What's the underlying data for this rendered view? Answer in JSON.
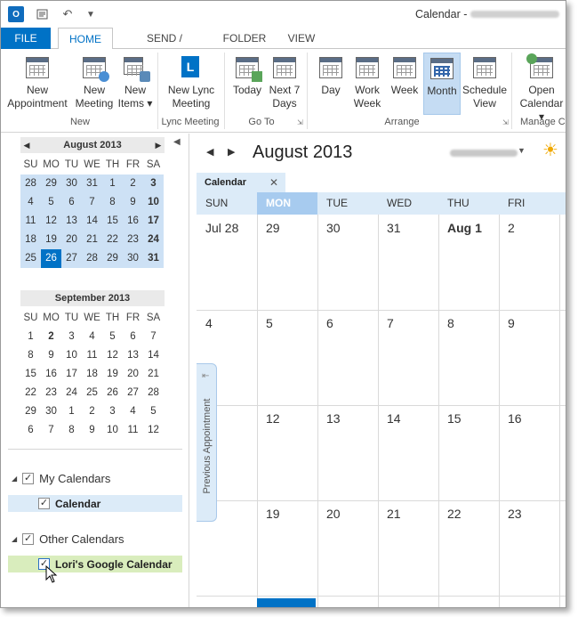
{
  "title_bar": {
    "title": "Calendar -",
    "app_icon_text": "O",
    "icons": [
      "outlook-app-icon",
      "send-receive-icon",
      "undo-icon",
      "customize-quick-access-icon"
    ]
  },
  "tabs": [
    "FILE",
    "HOME",
    "SEND / RECEIVE",
    "FOLDER",
    "VIEW"
  ],
  "ribbon": {
    "buttons": {
      "new_appointment": "New\nAppointment",
      "new_meeting": "New\nMeeting",
      "new_items": "New\nItems ▾",
      "new_lync_meeting": "New Lync\nMeeting",
      "today": "Today",
      "next7": "Next 7\nDays",
      "day": "Day",
      "work_week": "Work\nWeek",
      "week": "Week",
      "month": "Month",
      "schedule_view": "Schedule\nView",
      "open_calendar": "Open\nCalendar ▾"
    },
    "groups": {
      "new": "New",
      "lync_meeting": "Lync Meeting",
      "go_to": "Go To",
      "arrange": "Arrange",
      "manage": "Manage C"
    }
  },
  "nav_pane": {
    "august": {
      "header": "August 2013",
      "dows": [
        "SU",
        "MO",
        "TU",
        "WE",
        "TH",
        "FR",
        "SA"
      ],
      "weeks": [
        [
          "28",
          "29",
          "30",
          "31",
          "1",
          "2",
          "3"
        ],
        [
          "4",
          "5",
          "6",
          "7",
          "8",
          "9",
          "10"
        ],
        [
          "11",
          "12",
          "13",
          "14",
          "15",
          "16",
          "17"
        ],
        [
          "18",
          "19",
          "20",
          "21",
          "22",
          "23",
          "24"
        ],
        [
          "25",
          "26",
          "27",
          "28",
          "29",
          "30",
          "31"
        ]
      ],
      "today": "26"
    },
    "september": {
      "header": "September 2013",
      "dows": [
        "SU",
        "MO",
        "TU",
        "WE",
        "TH",
        "FR",
        "SA"
      ],
      "weeks": [
        [
          "1",
          "2",
          "3",
          "4",
          "5",
          "6",
          "7"
        ],
        [
          "8",
          "9",
          "10",
          "11",
          "12",
          "13",
          "14"
        ],
        [
          "15",
          "16",
          "17",
          "18",
          "19",
          "20",
          "21"
        ],
        [
          "22",
          "23",
          "24",
          "25",
          "26",
          "27",
          "28"
        ],
        [
          "29",
          "30",
          "1",
          "2",
          "3",
          "4",
          "5"
        ],
        [
          "6",
          "7",
          "8",
          "9",
          "10",
          "11",
          "12"
        ]
      ]
    },
    "my_calendars": "My Calendars",
    "calendar_item": "Calendar",
    "other_calendars": "Other Calendars",
    "google_calendar": "Lori's Google Calendar"
  },
  "main": {
    "month_title": "August 2013",
    "tab_label": "Calendar",
    "dows": [
      "SUN",
      "MON",
      "TUE",
      "WED",
      "THU",
      "FRI"
    ],
    "selected_dow": "MON",
    "weeks": [
      [
        "Jul 28",
        "29",
        "30",
        "31",
        "Aug 1",
        "2"
      ],
      [
        "4",
        "5",
        "6",
        "7",
        "8",
        "9"
      ],
      [
        "",
        "12",
        "13",
        "14",
        "15",
        "16"
      ],
      [
        "",
        "19",
        "20",
        "21",
        "22",
        "23"
      ]
    ],
    "prev_appointment": "Previous Appointment"
  },
  "colors": {
    "accent": "#0072c6",
    "selected_light": "#cde1f5",
    "google_calendar": "#d9edbd"
  }
}
